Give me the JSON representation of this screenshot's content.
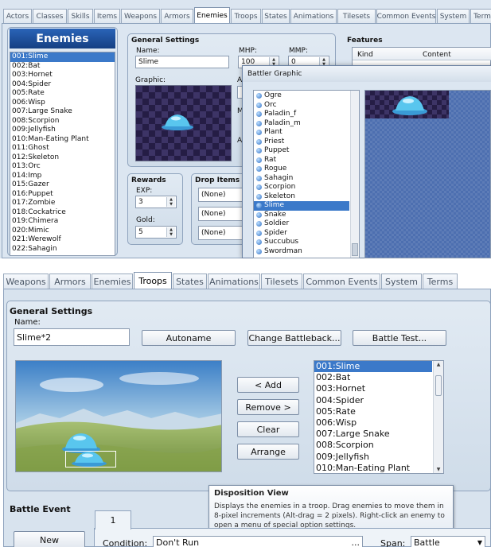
{
  "top": {
    "tabs": [
      "Actors",
      "Classes",
      "Skills",
      "Items",
      "Weapons",
      "Armors",
      "Enemies",
      "Troops",
      "States",
      "Animations",
      "Tilesets",
      "Common Events",
      "System",
      "Term"
    ],
    "active_tab": "Enemies",
    "list_title": "Enemies",
    "enemy_list": [
      "001:Slime",
      "002:Bat",
      "003:Hornet",
      "004:Spider",
      "005:Rate",
      "006:Wisp",
      "007:Large Snake",
      "008:Scorpion",
      "009:Jellyfish",
      "010:Man-Eating Plant",
      "011:Ghost",
      "012:Skeleton",
      "013:Orc",
      "014:Imp",
      "015:Gazer",
      "016:Puppet",
      "017:Zombie",
      "018:Cockatrice",
      "019:Chimera",
      "020:Mimic",
      "021:Werewolf",
      "022:Sahagin"
    ],
    "selected_enemy": "001:Slime",
    "general": {
      "title": "General Settings",
      "name_label": "Name:",
      "name_value": "Slime",
      "mhp_label": "MHP:",
      "mhp_value": "100",
      "mmp_label": "MMP:",
      "mmp_value": "0",
      "graphic_label": "Graphic:"
    },
    "rewards": {
      "title": "Rewards",
      "exp_label": "EXP:",
      "exp_value": "3",
      "gold_label": "Gold:",
      "gold_value": "5"
    },
    "drops": {
      "title": "Drop Items",
      "items": [
        "(None)",
        "(None)",
        "(None)"
      ]
    },
    "features": {
      "title": "Features",
      "col_kind": "Kind",
      "col_content": "Content"
    },
    "battler_dialog": {
      "title": "Battler Graphic",
      "files": [
        "Ogre",
        "Orc",
        "Paladin_f",
        "Paladin_m",
        "Plant",
        "Priest",
        "Puppet",
        "Rat",
        "Rogue",
        "Sahagin",
        "Scorpion",
        "Skeleton",
        "Slime",
        "Snake",
        "Soldier",
        "Spider",
        "Succubus",
        "Swordman"
      ],
      "selected": "Slime"
    }
  },
  "bottom": {
    "tabs": [
      "Weapons",
      "Armors",
      "Enemies",
      "Troops",
      "States",
      "Animations",
      "Tilesets",
      "Common Events",
      "System",
      "Terms"
    ],
    "active_tab": "Troops",
    "general_title": "General Settings",
    "name_label": "Name:",
    "name_value": "Slime*2",
    "autoname": "Autoname",
    "change_battleback": "Change Battleback...",
    "battle_test": "Battle Test...",
    "add": "< Add",
    "remove": "Remove >",
    "clear": "Clear",
    "arrange": "Arrange",
    "enemy_list": [
      "001:Slime",
      "002:Bat",
      "003:Hornet",
      "004:Spider",
      "005:Rate",
      "006:Wisp",
      "007:Large Snake",
      "008:Scorpion",
      "009:Jellyfish",
      "010:Man-Eating Plant"
    ],
    "selected_enemy": "001:Slime",
    "tooltip": {
      "title": "Disposition View",
      "body": "Displays the enemies in a troop. Drag enemies to move them in 8-pixel increments (Alt-drag = 2 pixels). Right-click an enemy to open a menu of special option settings."
    },
    "battle_event_title": "Battle Event",
    "new_button": "New",
    "page_tab": "1",
    "condition_label": "Condition:",
    "condition_value": "Don't Run",
    "condition_btn": "...",
    "span_label": "Span:",
    "span_value": "Battle"
  },
  "colors": {
    "selection": "#3b79c9",
    "title_bar": "#1e4f9a",
    "panel": "#d6e1ec"
  }
}
